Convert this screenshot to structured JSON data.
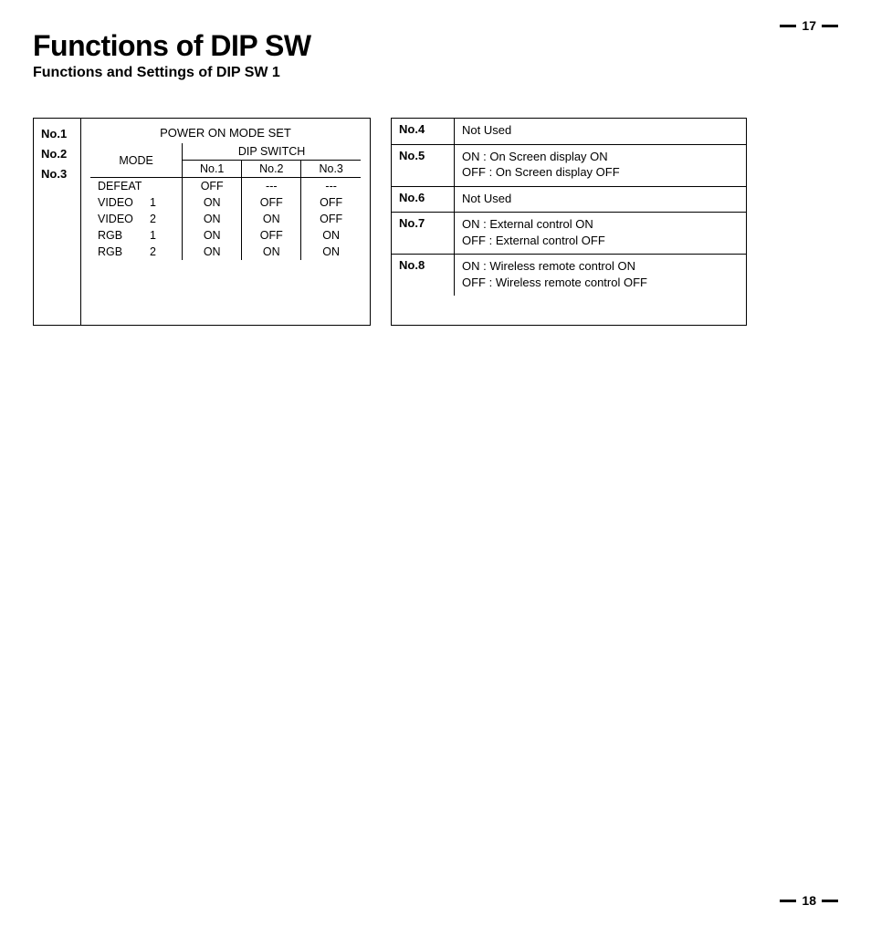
{
  "page": {
    "top_number": "17",
    "bottom_number": "18",
    "title": "Functions of DIP SW",
    "subtitle": "Functions and Settings of DIP SW 1"
  },
  "left": {
    "nums": [
      "No.1",
      "No.2",
      "No.3"
    ],
    "caption": "POWER ON MODE SET",
    "mode_header": "MODE",
    "dip_header": "DIP SWITCH",
    "cols": [
      "No.1",
      "No.2",
      "No.3"
    ],
    "rows": [
      {
        "mode_name": "DEFEAT",
        "mode_num": "",
        "v": [
          "OFF",
          "---",
          "---"
        ]
      },
      {
        "mode_name": "VIDEO",
        "mode_num": "1",
        "v": [
          "ON",
          "OFF",
          "OFF"
        ]
      },
      {
        "mode_name": "VIDEO",
        "mode_num": "2",
        "v": [
          "ON",
          "ON",
          "OFF"
        ]
      },
      {
        "mode_name": "RGB",
        "mode_num": "1",
        "v": [
          "ON",
          "OFF",
          "ON"
        ]
      },
      {
        "mode_name": "RGB",
        "mode_num": "2",
        "v": [
          "ON",
          "ON",
          "ON"
        ]
      }
    ]
  },
  "right": [
    {
      "label": "No.4",
      "lines": [
        "Not Used"
      ]
    },
    {
      "label": "No.5",
      "lines": [
        "ON   :  On Screen display ON",
        "OFF :  On Screen display OFF"
      ]
    },
    {
      "label": "No.6",
      "lines": [
        "Not Used"
      ]
    },
    {
      "label": "No.7",
      "lines": [
        "ON   :  External control ON",
        "OFF :  External control OFF"
      ]
    },
    {
      "label": "No.8",
      "lines": [
        "ON   :  Wireless remote control ON",
        "OFF :  Wireless remote control OFF"
      ]
    }
  ]
}
